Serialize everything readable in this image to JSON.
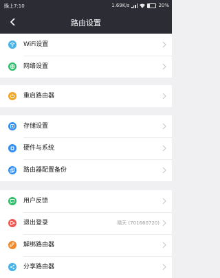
{
  "status": {
    "time": "晚上7:10",
    "speed": "1.69K/s",
    "battery": "20%",
    "battery_level": 0.2
  },
  "header": {
    "title": "路由设置",
    "back_icon": "back-arrow-icon"
  },
  "groups": [
    [
      {
        "label": "WiFi设置",
        "icon": "wifi-icon",
        "color": "#45b3e8"
      },
      {
        "label": "网络设置",
        "icon": "globe-icon",
        "color": "#2ebd6a"
      }
    ],
    [
      {
        "label": "重启路由器",
        "icon": "power-icon",
        "color": "#f2a527"
      }
    ],
    [
      {
        "label": "存储设置",
        "icon": "storage-icon",
        "color": "#2f8ff0"
      },
      {
        "label": "硬件与系统",
        "icon": "hardware-icon",
        "color": "#2f8ff0"
      },
      {
        "label": "路由器配置备份",
        "icon": "backup-icon",
        "color": "#2f8ff0"
      }
    ],
    [
      {
        "label": "用户反馈",
        "icon": "feedback-icon",
        "color": "#2ebd6a"
      },
      {
        "label": "退出登录",
        "icon": "logout-icon",
        "color": "#ee5a53",
        "value": "晴天 (701660720)"
      },
      {
        "label": "解绑路由器",
        "icon": "unbind-icon",
        "color": "#f28a2b"
      },
      {
        "label": "分享路由器",
        "icon": "share-icon",
        "color": "#45b3e8"
      }
    ]
  ]
}
